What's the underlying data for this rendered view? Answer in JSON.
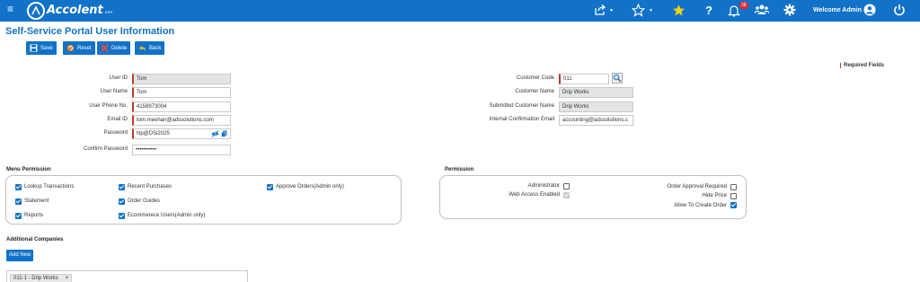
{
  "header": {
    "app_name": "Accolent",
    "app_suffix": "ERP",
    "notification_count": "38",
    "welcome_text": "Welcome Admin",
    "brand_color": "#1172c8"
  },
  "page": {
    "title": "Self-Service Portal User Information",
    "required_fields": "Required Fields"
  },
  "toolbar": {
    "save": "Save",
    "reset": "Reset",
    "delete": "Delete",
    "back": "Back"
  },
  "user_form": {
    "user_id": {
      "label": "User ID",
      "value": "Tom"
    },
    "user_name": {
      "label": "User Name",
      "value": "Tom"
    },
    "phone": {
      "label": "User Phone No.",
      "value": "4158973004"
    },
    "email": {
      "label": "Email ID",
      "value": "tom.meehan@adssolutions.com"
    },
    "password": {
      "label": "Password",
      "value": "Np@DSi2025"
    },
    "confirm_password": {
      "label": "Confirm Password",
      "value": "•••••••••••"
    }
  },
  "customer_form": {
    "customer_code": {
      "label": "Customer Code",
      "value": "011"
    },
    "customer_name": {
      "label": "Customer Name",
      "value": "Drip Works"
    },
    "submitted_customer_name": {
      "label": "Submitted Customer Name",
      "value": "Drip Works"
    },
    "internal_email": {
      "label": "Internal Confirmation Email",
      "value": "accounting@adssolutions.c"
    }
  },
  "menu_permission": {
    "title": "Menu Permission",
    "items": [
      {
        "label": "Lookup Transactions",
        "checked": true
      },
      {
        "label": "Statement",
        "checked": true
      },
      {
        "label": "Reports",
        "checked": true
      },
      {
        "label": "Recent Purchases",
        "checked": true
      },
      {
        "label": "Order Guides",
        "checked": true
      },
      {
        "label": "Ecommerece Users(Admin only)",
        "checked": true
      },
      {
        "label": "Approve Orders(Admin only)",
        "checked": true
      }
    ]
  },
  "permission": {
    "title": "Permission",
    "administrator": {
      "label": "Administrator",
      "checked": false
    },
    "web_access": {
      "label": "Web Access Enabled",
      "checked": true,
      "disabled": true
    },
    "order_approval": {
      "label": "Order Approval Required",
      "checked": false
    },
    "hide_price": {
      "label": "Hide Price",
      "checked": false
    },
    "allow_create_order": {
      "label": "Allow To Create Order",
      "checked": true
    }
  },
  "additional_companies": {
    "title": "Additional Companies",
    "add_new": "Add New",
    "tags": [
      {
        "label": "011-1 - Drip Works",
        "remove": "×"
      }
    ]
  }
}
